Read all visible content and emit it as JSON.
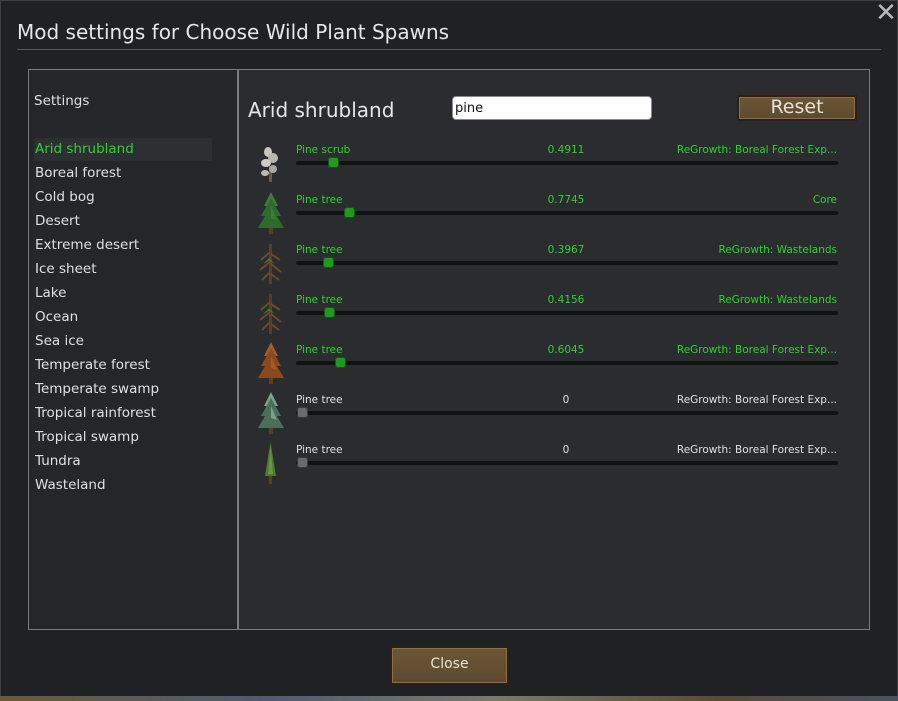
{
  "window": {
    "title": "Mod settings for Choose Wild Plant Spawns"
  },
  "sidebar": {
    "heading": "Settings",
    "items": [
      {
        "label": "Arid shrubland",
        "selected": true
      },
      {
        "label": "Boreal forest"
      },
      {
        "label": "Cold bog"
      },
      {
        "label": "Desert"
      },
      {
        "label": "Extreme desert"
      },
      {
        "label": "Ice sheet"
      },
      {
        "label": "Lake"
      },
      {
        "label": "Ocean"
      },
      {
        "label": "Sea ice"
      },
      {
        "label": "Temperate forest"
      },
      {
        "label": "Temperate swamp"
      },
      {
        "label": "Tropical rainforest"
      },
      {
        "label": "Tropical swamp"
      },
      {
        "label": "Tundra"
      },
      {
        "label": "Wasteland"
      }
    ]
  },
  "main": {
    "biome_title": "Arid shrubland",
    "search_value": "pine",
    "reset_label": "Reset",
    "plants": [
      {
        "name": "Pine scrub",
        "value": "0.4911",
        "level": 0.057,
        "source": "ReGrowth: Boreal Forest Exp...",
        "active": true,
        "icon": "pine-scrub-icon"
      },
      {
        "name": "Pine tree",
        "value": "0.7745",
        "level": 0.087,
        "source": "Core",
        "active": true,
        "icon": "pine-tree-icon"
      },
      {
        "name": "Pine tree",
        "value": "0.3967",
        "level": 0.048,
        "source": "ReGrowth: Wastelands",
        "active": true,
        "icon": "dead-pine-tree-icon"
      },
      {
        "name": "Pine tree",
        "value": "0.4156",
        "level": 0.05,
        "source": "ReGrowth: Wastelands",
        "active": true,
        "icon": "dead-pine-tree-icon"
      },
      {
        "name": "Pine tree",
        "value": "0.6045",
        "level": 0.07,
        "source": "ReGrowth: Boreal Forest Exp...",
        "active": true,
        "icon": "autumn-pine-tree-icon"
      },
      {
        "name": "Pine tree",
        "value": "0",
        "level": 0,
        "source": "ReGrowth: Boreal Forest Exp...",
        "active": false,
        "icon": "frosted-pine-tree-icon"
      },
      {
        "name": "Pine tree",
        "value": "0",
        "level": 0,
        "source": "ReGrowth: Boreal Forest Exp...",
        "active": false,
        "icon": "slim-pine-tree-icon"
      }
    ]
  },
  "footer": {
    "close_label": "Close"
  },
  "colors": {
    "accent_green": "#2ad52a",
    "button_brown": "#6c5635"
  }
}
